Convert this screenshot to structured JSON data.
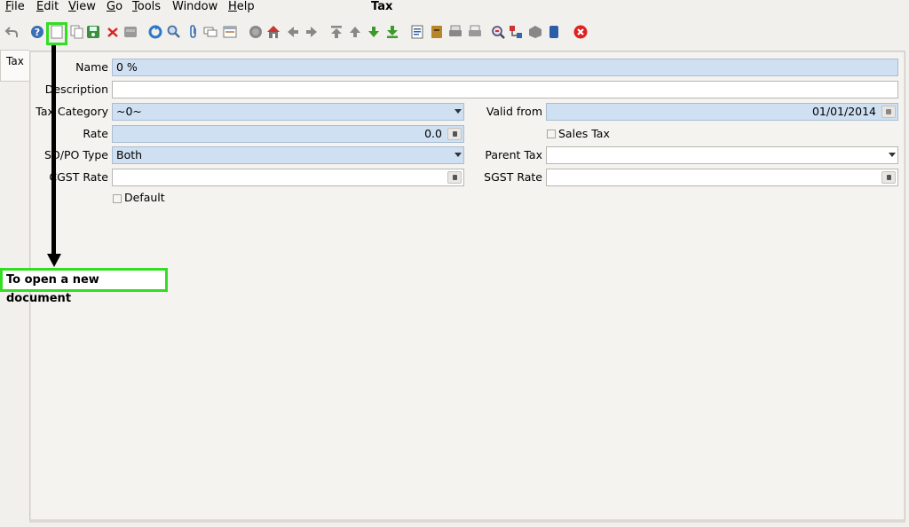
{
  "menubar": {
    "items": [
      {
        "label": "File",
        "mnemonic": "F",
        "rest": "ile"
      },
      {
        "label": "Edit",
        "mnemonic": "E",
        "rest": "dit"
      },
      {
        "label": "View",
        "mnemonic": "V",
        "rest": "iew"
      },
      {
        "label": "Go",
        "mnemonic": "G",
        "rest": "o"
      },
      {
        "label": "Tools",
        "mnemonic": "T",
        "rest": "ools"
      },
      {
        "label": "Window",
        "mnemonic": "",
        "rest": "Window"
      },
      {
        "label": "Help",
        "mnemonic": "H",
        "rest": "elp"
      }
    ]
  },
  "window_title": "Tax",
  "toolbar": {
    "icons": [
      "undo-icon",
      "help-icon",
      "new-record-icon",
      "copy-record-icon",
      "save-icon",
      "delete-icon",
      "save-disabled-icon",
      "refresh-icon",
      "find-icon",
      "attachment-icon",
      "chat-icon",
      "grid-toggle-icon",
      "history-icon",
      "home-icon",
      "previous-icon",
      "next-icon",
      "first-record-icon",
      "previous-record-icon",
      "next-record-icon",
      "last-record-icon",
      "report-icon",
      "archive-icon",
      "print-preview-icon",
      "print-icon",
      "zoom-across-icon",
      "workflow-icon",
      "product-info-icon",
      "process-icon",
      "exit-icon"
    ]
  },
  "tab": {
    "label": "Tax"
  },
  "form": {
    "name": {
      "label": "Name",
      "value": "0 %"
    },
    "description": {
      "label": "Description",
      "value": ""
    },
    "tax_category": {
      "label": "Tax Category",
      "value": "~0~"
    },
    "valid_from": {
      "label": "Valid from",
      "value": "01/01/2014"
    },
    "rate": {
      "label": "Rate",
      "value": "0.0"
    },
    "sales_tax": {
      "label": "Sales Tax",
      "checked": false
    },
    "so_po_type": {
      "label": "SO/PO Type",
      "value": "Both"
    },
    "parent_tax": {
      "label": "Parent Tax",
      "value": ""
    },
    "cgst_rate": {
      "label": "CGST Rate",
      "value": ""
    },
    "sgst_rate": {
      "label": "SGST Rate",
      "value": ""
    },
    "default": {
      "label": "Default",
      "checked": false
    }
  },
  "annotation": {
    "callout_text": "To open a new document",
    "highlight_color": "#33dd22"
  }
}
